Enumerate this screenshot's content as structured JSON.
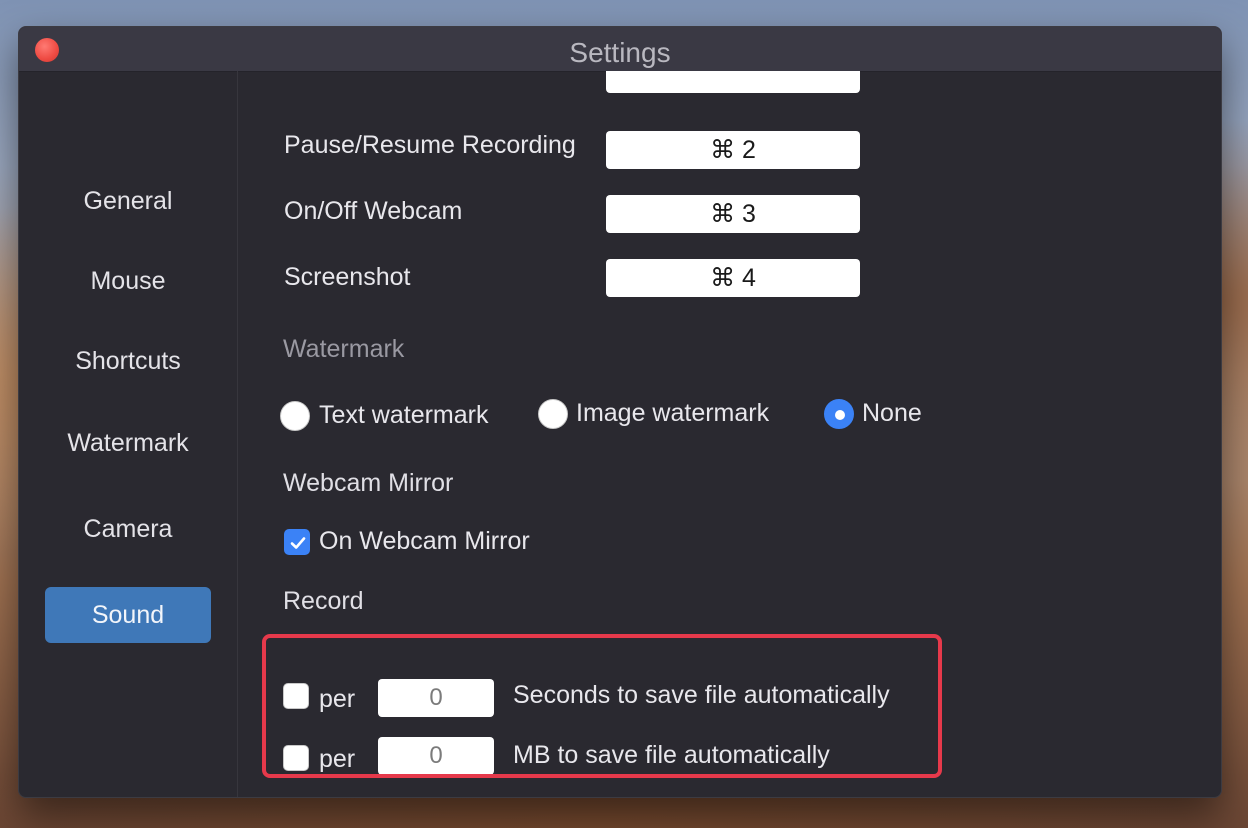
{
  "window": {
    "title": "Settings"
  },
  "sidebar": {
    "items": [
      {
        "label": "General"
      },
      {
        "label": "Mouse"
      },
      {
        "label": "Shortcuts"
      },
      {
        "label": "Watermark"
      },
      {
        "label": "Camera"
      },
      {
        "label": "Sound"
      }
    ],
    "active": "Sound"
  },
  "shortcuts": [
    {
      "label": "Pause/Resume Recording",
      "key": "⌘ 2"
    },
    {
      "label": "On/Off Webcam",
      "key": "⌘ 3"
    },
    {
      "label": "Screenshot",
      "key": "⌘ 4"
    }
  ],
  "watermark": {
    "heading": "Watermark",
    "options": [
      {
        "label": "Text watermark",
        "selected": false
      },
      {
        "label": "Image watermark",
        "selected": false
      },
      {
        "label": "None",
        "selected": true
      }
    ]
  },
  "webcam_mirror": {
    "heading": "Webcam Mirror",
    "checkbox_label": "On Webcam Mirror",
    "checked": true
  },
  "record": {
    "heading": "Record",
    "rows": [
      {
        "per_label": "per",
        "value": "0",
        "description": "Seconds to save file automatically",
        "checked": false
      },
      {
        "per_label": "per",
        "value": "0",
        "description": "MB to save file automatically",
        "checked": false
      }
    ]
  },
  "colors": {
    "accent": "#3b82f6",
    "sidebar_active": "#3f78b8",
    "highlight": "#e6394b",
    "window_bg": "#2a2930"
  }
}
